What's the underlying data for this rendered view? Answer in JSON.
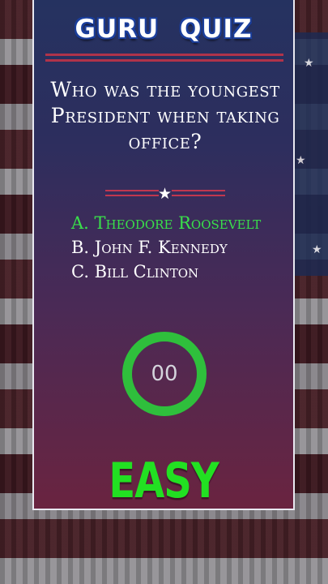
{
  "app": {
    "title": "GURU QUIZ"
  },
  "question": {
    "text": "Who was the youngest President when taking office?"
  },
  "options": [
    {
      "label": "A. Theodore Roosevelt",
      "correct": true
    },
    {
      "label": "B. John F. Kennedy",
      "correct": false
    },
    {
      "label": "C. Bill Clinton",
      "correct": false
    }
  ],
  "timer": {
    "value": "00",
    "progress": 1.0,
    "color": "#2fbf3c",
    "track_color": "#2e3a4a"
  },
  "difficulty": {
    "label": "EASY",
    "color": "#22e022"
  },
  "icons": {
    "divider": "star-icon"
  }
}
